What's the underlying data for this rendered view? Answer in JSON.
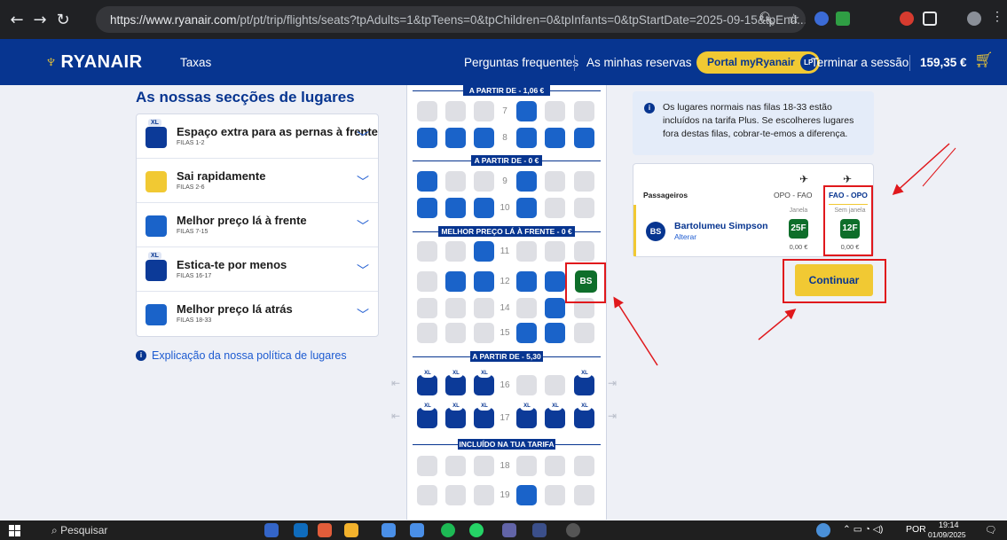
{
  "browser": {
    "url_domain": "https://www.ryanair.com",
    "url_rest": "/pt/pt/trip/flights/seats?tpAdults=1&tpTeens=0&tpChildren=0&tpInfants=0&tpStartDate=2025-09-15&tpEnd..."
  },
  "header": {
    "logo": "RYANAIR",
    "taxas": "Taxas",
    "faq": "Perguntas frequentes",
    "reservas": "As minhas reservas",
    "portal": "Portal myRyanair",
    "portal_badge": "LP",
    "logout": "Terminar a sessão",
    "total": "159,35 €"
  },
  "sections": {
    "title": "As nossas secções de lugares",
    "items": [
      {
        "title": "Espaço extra para as pernas à frente",
        "sub": "FILAS 1-2",
        "badge": "XL",
        "color": "#0c3a98"
      },
      {
        "title": "Sai rapidamente",
        "sub": "FILAS 2-6",
        "badge": "",
        "color": "#f1c933"
      },
      {
        "title": "Melhor preço lá à frente",
        "sub": "FILAS 7-15",
        "badge": "",
        "color": "#1a63c9"
      },
      {
        "title": "Estica-te por menos",
        "sub": "FILAS 16-17",
        "badge": "XL",
        "color": "#0c3a98"
      },
      {
        "title": "Melhor preço lá atrás",
        "sub": "FILAS 18-33",
        "badge": "",
        "color": "#1a63c9"
      }
    ],
    "policy": "Explicação da nossa política de lugares"
  },
  "seatmap": {
    "bands": [
      "A PARTIR DE - 1,06 €",
      "A PARTIR DE - 0 €",
      "MELHOR PREÇO LÁ À FRENTE - 0 €",
      "A PARTIR DE - 5,30 €",
      "INCLUÍDO NA TUA TARIFA"
    ],
    "xl_label": "XL",
    "rows": [
      {
        "n": "7",
        "seats": [
          "e",
          "e",
          "e",
          "b",
          "e",
          "e"
        ]
      },
      {
        "n": "8",
        "seats": [
          "b",
          "b",
          "b",
          "b",
          "b",
          "b"
        ]
      },
      {
        "n": "9",
        "seats": [
          "b",
          "e",
          "e",
          "b",
          "e",
          "e"
        ]
      },
      {
        "n": "10",
        "seats": [
          "b",
          "b",
          "b",
          "b",
          "e",
          "e"
        ]
      },
      {
        "n": "11",
        "seats": [
          "e",
          "e",
          "b",
          "e",
          "e",
          "e"
        ]
      },
      {
        "n": "12",
        "seats": [
          "e",
          "b",
          "b",
          "b",
          "b",
          "x"
        ]
      },
      {
        "n": "14",
        "seats": [
          "e",
          "e",
          "e",
          "e",
          "b",
          "e"
        ]
      },
      {
        "n": "15",
        "seats": [
          "e",
          "e",
          "e",
          "b",
          "b",
          "e"
        ]
      },
      {
        "n": "16",
        "seats": [
          "d",
          "d",
          "d",
          "e",
          "e",
          "d"
        ]
      },
      {
        "n": "17",
        "seats": [
          "d",
          "d",
          "d",
          "d",
          "d",
          "d"
        ]
      },
      {
        "n": "18",
        "seats": [
          "e",
          "e",
          "e",
          "e",
          "e",
          "e"
        ]
      },
      {
        "n": "19",
        "seats": [
          "e",
          "e",
          "e",
          "b",
          "e",
          "e"
        ]
      }
    ],
    "selected": "BS"
  },
  "info": {
    "text": "Os lugares normais nas filas 18-33 estão incluídos na tarifa Plus. Se escolheres lugares fora destas filas, cobrar-te-emos a diferença."
  },
  "passengers": {
    "header": "Passageiros",
    "flight1": "OPO - FAO",
    "flight2": "FAO - OPO",
    "initials": "BS",
    "name": "Bartolumeu Simpson",
    "change": "Alterar",
    "seat1_label": "Janela",
    "seat1": "25F",
    "seat1_price": "0,00 €",
    "seat2_label": "Sem janela",
    "seat2": "12F",
    "seat2_price": "0,00 €"
  },
  "continue": "Continuar",
  "taskbar": {
    "search": "Pesquisar",
    "lang": "POR",
    "time": "19:14",
    "date": "01/09/2025"
  },
  "colors": {
    "brand": "#073590",
    "accent": "#f1c933",
    "highlight": "#e0181c"
  }
}
